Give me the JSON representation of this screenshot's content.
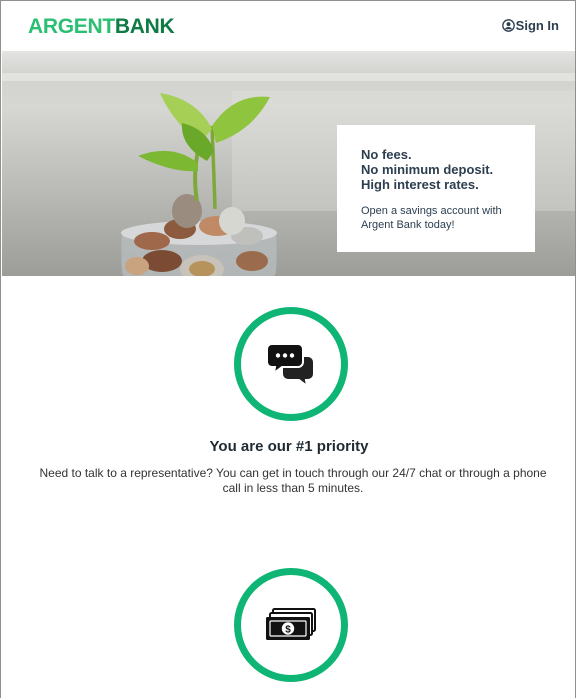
{
  "brand": {
    "part1": "ARGENT",
    "part2": "BANK",
    "color_light": "#2bbf73",
    "color_dark": "#0e7a44"
  },
  "header": {
    "signin_label": "Sign In",
    "signin_icon": "user-circle-icon"
  },
  "hero": {
    "headline_1": "No fees.",
    "headline_2": "No minimum deposit.",
    "headline_3": "High interest rates.",
    "body": "Open a savings account with Argent Bank today!"
  },
  "features": [
    {
      "icon": "chat-icon",
      "title": "You are our #1 priority",
      "text": "Need to talk to a representative? You can get in touch through our 24/7 chat or through a phone call in less than 5 minutes."
    },
    {
      "icon": "money-icon",
      "title": "",
      "text": ""
    }
  ],
  "accent_color": "#0fb574"
}
